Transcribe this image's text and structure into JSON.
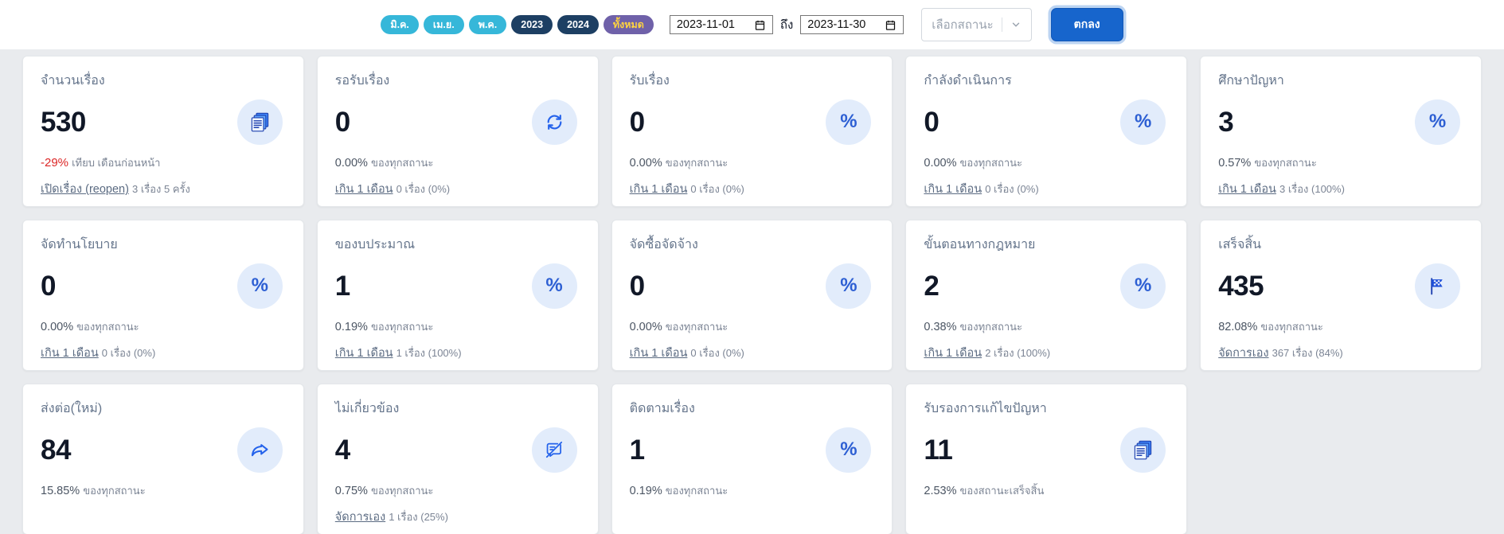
{
  "filter_bar": {
    "pills": [
      {
        "label": "มิ.ค."
      },
      {
        "label": "เม.ย."
      },
      {
        "label": "พ.ค."
      },
      {
        "label": "2023"
      },
      {
        "label": "2024"
      },
      {
        "label": "ทั้งหมด"
      }
    ],
    "date_from": "2023-11-01",
    "to_label": "ถึง",
    "date_to": "2023-11-30",
    "status_placeholder": "เลือกสถานะ",
    "submit_label": "ตกลง"
  },
  "icon_glyphs": {
    "percent": "%"
  },
  "colors": {
    "accent": "#1765cc",
    "month_pill": "#36b7d9",
    "year_pill": "#1d3f63",
    "all_pill": "#6f61a9",
    "all_pill_text": "#ffd43f",
    "icon_circle_bg": "#e2ecfb",
    "icon_fg": "#2563eb",
    "negative": "#dc2626",
    "page_bg": "#e9ebee"
  },
  "cards": [
    {
      "title": "จำนวนเรื่อง",
      "value": "530",
      "trend": "-29%",
      "trend_suffix": "เทียบ เดือนก่อนหน้า",
      "link": "เปิดเรื่อง (reopen)",
      "link_suffix": "3 เรื่อง 5 ครั้ง",
      "icon": "documents-icon"
    },
    {
      "title": "รอรับเรื่อง",
      "value": "0",
      "percent": "0.00%",
      "percent_suffix": "ของทุกสถานะ",
      "link": "เกิน 1 เดือน",
      "link_suffix": "0 เรื่อง (0%)",
      "icon": "refresh-icon"
    },
    {
      "title": "รับเรื่อง",
      "value": "0",
      "percent": "0.00%",
      "percent_suffix": "ของทุกสถานะ",
      "link": "เกิน 1 เดือน",
      "link_suffix": "0 เรื่อง (0%)",
      "icon": "percent-icon"
    },
    {
      "title": "กำลังดำเนินการ",
      "value": "0",
      "percent": "0.00%",
      "percent_suffix": "ของทุกสถานะ",
      "link": "เกิน 1 เดือน",
      "link_suffix": "0 เรื่อง (0%)",
      "icon": "percent-icon"
    },
    {
      "title": "ศึกษาปัญหา",
      "value": "3",
      "percent": "0.57%",
      "percent_suffix": "ของทุกสถานะ",
      "link": "เกิน 1 เดือน",
      "link_suffix": "3 เรื่อง (100%)",
      "icon": "percent-icon"
    },
    {
      "title": "จัดทำนโยบาย",
      "value": "0",
      "percent": "0.00%",
      "percent_suffix": "ของทุกสถานะ",
      "link": "เกิน 1 เดือน",
      "link_suffix": "0 เรื่อง (0%)",
      "icon": "percent-icon"
    },
    {
      "title": "ของบประมาณ",
      "value": "1",
      "percent": "0.19%",
      "percent_suffix": "ของทุกสถานะ",
      "link": "เกิน 1 เดือน",
      "link_suffix": "1 เรื่อง (100%)",
      "icon": "percent-icon"
    },
    {
      "title": "จัดซื้อจัดจ้าง",
      "value": "0",
      "percent": "0.00%",
      "percent_suffix": "ของทุกสถานะ",
      "link": "เกิน 1 เดือน",
      "link_suffix": "0 เรื่อง (0%)",
      "icon": "percent-icon"
    },
    {
      "title": "ขั้นตอนทางกฎหมาย",
      "value": "2",
      "percent": "0.38%",
      "percent_suffix": "ของทุกสถานะ",
      "link": "เกิน 1 เดือน",
      "link_suffix": "2 เรื่อง (100%)",
      "icon": "percent-icon"
    },
    {
      "title": "เสร็จสิ้น",
      "value": "435",
      "percent": "82.08%",
      "percent_suffix": "ของทุกสถานะ",
      "link": "จัดการเอง",
      "link_suffix": "367 เรื่อง (84%)",
      "icon": "finish-flag-icon"
    },
    {
      "title": "ส่งต่อ(ใหม่)",
      "value": "84",
      "percent": "15.85%",
      "percent_suffix": "ของทุกสถานะ",
      "icon": "share-forward-icon"
    },
    {
      "title": "ไม่เกี่ยวข้อง",
      "value": "4",
      "percent": "0.75%",
      "percent_suffix": "ของทุกสถานะ",
      "link": "จัดการเอง",
      "link_suffix": "1 เรื่อง (25%)",
      "icon": "chat-off-icon"
    },
    {
      "title": "ติดตามเรื่อง",
      "value": "1",
      "percent": "0.19%",
      "percent_suffix": "ของทุกสถานะ",
      "icon": "percent-icon"
    },
    {
      "title": "รับรองการแก้ไขปัญหา",
      "value": "11",
      "percent": "2.53%",
      "percent_suffix": "ของสถานะเสร็จสิ้น",
      "icon": "documents-icon"
    }
  ]
}
